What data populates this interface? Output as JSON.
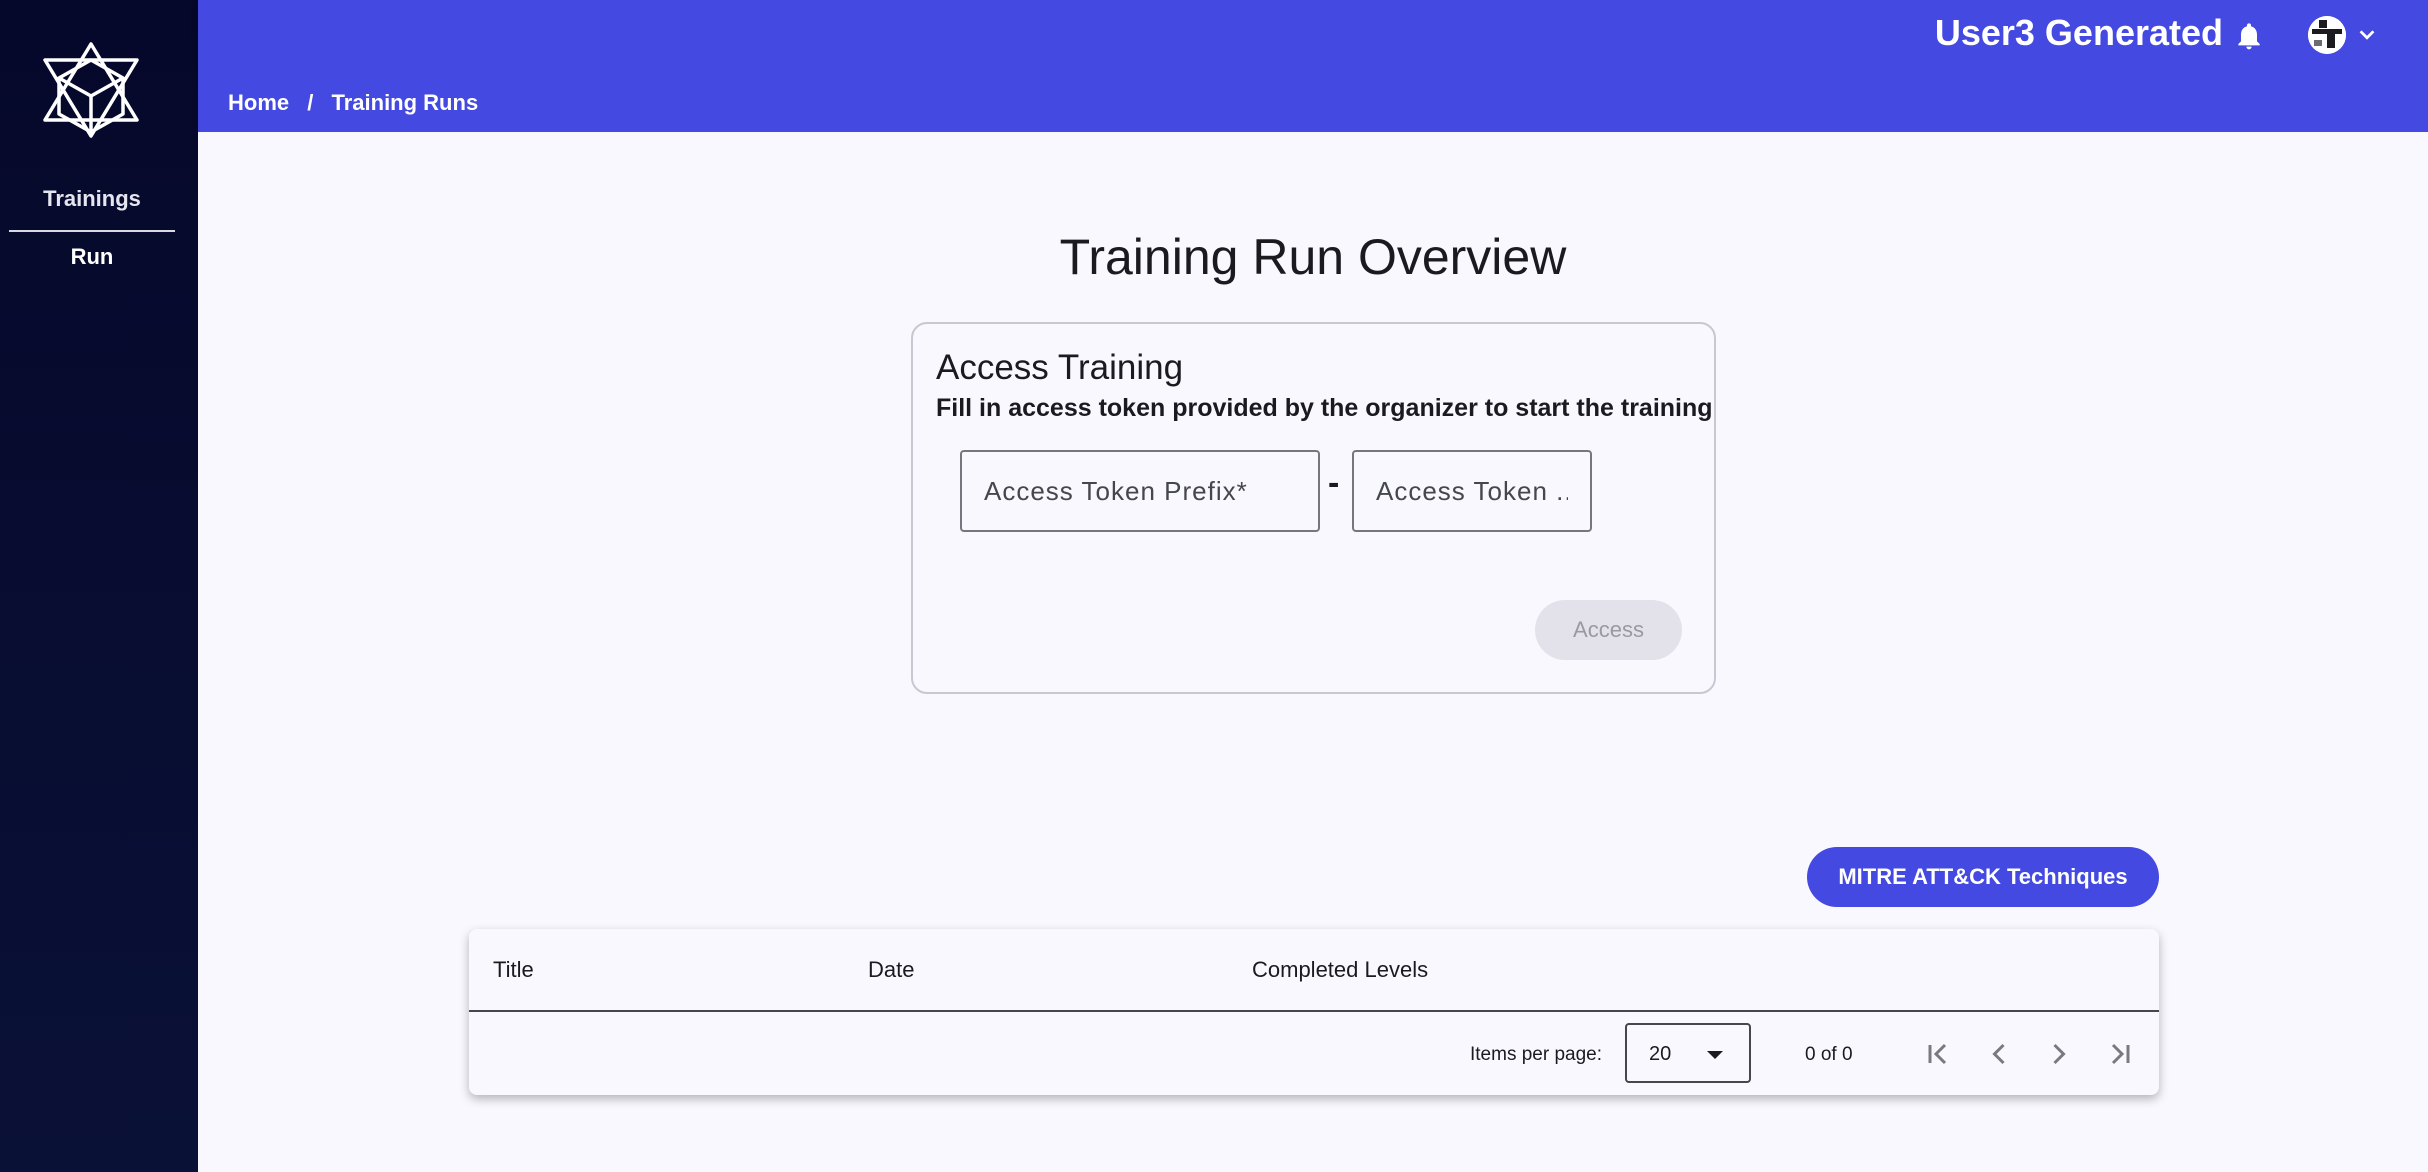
{
  "sidebar": {
    "items": [
      {
        "label": "Trainings"
      },
      {
        "label": "Run"
      }
    ]
  },
  "topbar": {
    "user_name": "User3 Generated",
    "icons": [
      "bell-icon",
      "avatar",
      "chevron-down-icon"
    ]
  },
  "breadcrumb": {
    "home": "Home",
    "separator": "/",
    "current": "Training Runs"
  },
  "page": {
    "title": "Training Run Overview"
  },
  "access_card": {
    "title": "Access Training",
    "subtitle": "Fill in access token provided by the organizer to start the training",
    "prefix_placeholder": "Access Token Prefix*",
    "suffix_placeholder": "Access Token ...",
    "dash": "-",
    "access_button": "Access"
  },
  "mitre_button": "MITRE ATT&CK Techniques",
  "table": {
    "columns": [
      "Title",
      "Date",
      "Completed Levels"
    ],
    "rows": [],
    "paginator": {
      "items_per_page_label": "Items per page:",
      "items_per_page": "20",
      "range": "0 of 0"
    }
  },
  "colors": {
    "primary": "#4349e1",
    "sidebar": "#05082a",
    "background": "#f9f8fe"
  }
}
